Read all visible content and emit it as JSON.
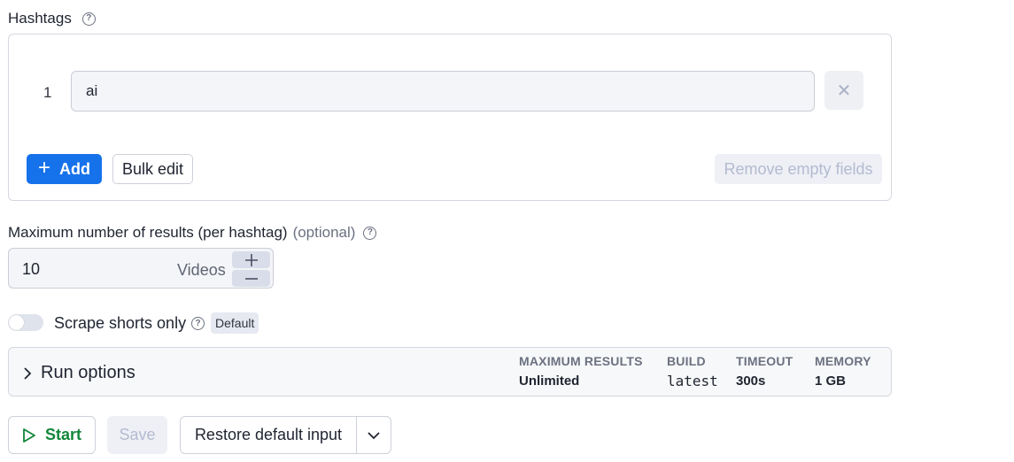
{
  "hashtags": {
    "label": "Hashtags",
    "help_icon": "question-circle-icon",
    "items": [
      {
        "index": "1",
        "value": "ai"
      }
    ],
    "remove_icon": "close-icon",
    "add_label": "Add",
    "add_icon": "plus-icon",
    "bulk_edit_label": "Bulk edit",
    "remove_empty_label": "Remove empty fields"
  },
  "max_results": {
    "label": "Maximum number of results (per hashtag)",
    "optional_label": "(optional)",
    "value": "10",
    "unit": "Videos",
    "increment_icon": "plus-icon",
    "decrement_icon": "minus-icon"
  },
  "scrape_shorts": {
    "label": "Scrape shorts only",
    "enabled": false,
    "badge": "Default"
  },
  "run_options": {
    "title": "Run options",
    "expand_icon": "chevron-right-icon",
    "stats": [
      {
        "header": "MAXIMUM RESULTS",
        "value": "Unlimited"
      },
      {
        "header": "BUILD",
        "value": "latest"
      },
      {
        "header": "TIMEOUT",
        "value": "300s"
      },
      {
        "header": "MEMORY",
        "value": "1 GB"
      }
    ]
  },
  "actions": {
    "start_label": "Start",
    "start_icon": "play-icon",
    "save_label": "Save",
    "restore_label": "Restore default input",
    "dropdown_icon": "chevron-down-icon"
  },
  "colors": {
    "primary": "#1672eb",
    "start_green": "#12873b",
    "disabled_text": "#b4bbd0"
  }
}
